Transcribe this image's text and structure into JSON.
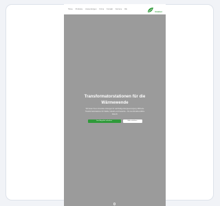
{
  "nav": {
    "links": [
      "Home",
      "Produkte",
      "Anwendungen",
      "Firma",
      "Kontakt",
      "Karriere",
      "DE"
    ],
    "logo_text": "Greiner"
  },
  "hero": {
    "title": "Transformatorstationen für die Wärmewende",
    "text": "Wir bieten Ihnen innovative Lösungen für nachhaltige Energieversorgung. Effiziente Transformatorstationen für Städte, Industrie und Gewerbe – für eine klimafreundliche Zukunft.",
    "primary_button": "Jetzt Angebot anfordern",
    "secondary_button": "Mehr erfahren"
  },
  "colors": {
    "accent": "#2f9a3a",
    "hero_bg": "#9b9b9b",
    "page_bg": "#f1f3f7"
  }
}
